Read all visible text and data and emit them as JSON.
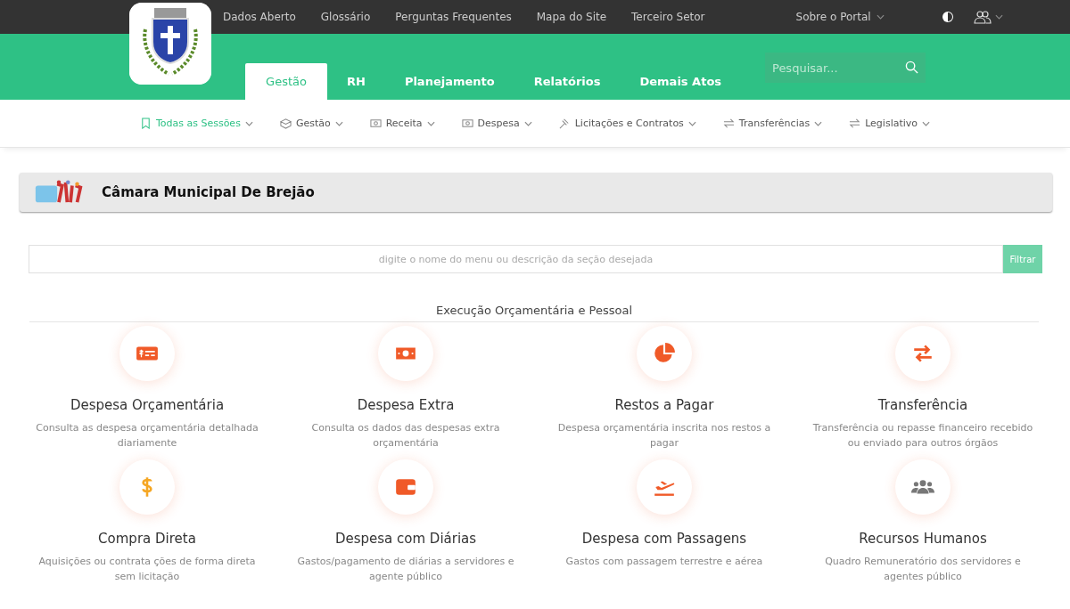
{
  "top_links": [
    "Dados Aberto",
    "Glossário",
    "Perguntas Frequentes",
    "Mapa do Site",
    "Terceiro Setor"
  ],
  "portal_menu": "Sobre o Portal",
  "tabs": [
    {
      "label": "Gestão",
      "selected": true
    },
    {
      "label": "RH",
      "selected": false
    },
    {
      "label": "Planejamento",
      "selected": false
    },
    {
      "label": "Relatórios",
      "selected": false
    },
    {
      "label": "Demais Atos",
      "selected": false
    }
  ],
  "search": {
    "placeholder": "Pesquisar..."
  },
  "subnav": [
    {
      "label": "Todas as Sessões",
      "kind": "bookmark",
      "selected": true
    },
    {
      "label": "Gestão",
      "kind": "box",
      "selected": false
    },
    {
      "label": "Receita",
      "kind": "money",
      "selected": false
    },
    {
      "label": "Despesa",
      "kind": "money",
      "selected": false
    },
    {
      "label": "Licitações e Contratos",
      "kind": "gavel",
      "selected": false
    },
    {
      "label": "Transferências",
      "kind": "exchange",
      "selected": false
    },
    {
      "label": "Legislativo",
      "kind": "exchange",
      "selected": false
    }
  ],
  "entity": {
    "title": "Câmara Municipal De Brejão"
  },
  "filter": {
    "placeholder": "digite o nome do menu ou descrição da seção desejada",
    "button": "Filtrar"
  },
  "section": {
    "title": "Execução Orçamentária e Pessoal",
    "cards": [
      {
        "kind": "check",
        "title": "Despesa Orçamentária",
        "description": "Consulta as despesa orçamentária detalhada diariamente"
      },
      {
        "kind": "bill",
        "title": "Despesa Extra",
        "description": "Consulta os dados das despesas extra orçamentária"
      },
      {
        "kind": "pie",
        "title": "Restos a Pagar",
        "description": "Despesa orçamentária inscrita nos restos a pagar"
      },
      {
        "kind": "exchange",
        "title": "Transferência",
        "description": "Transferência ou repasse financeiro recebido ou enviado para outros órgãos"
      },
      {
        "kind": "dollar",
        "title": "Compra Direta",
        "description": "Aquisições ou contrata ções de forma direta sem licitação"
      },
      {
        "kind": "wallet",
        "title": "Despesa com Diárias",
        "description": "Gastos/pagamento de diárias a servidores e agente público"
      },
      {
        "kind": "plane",
        "title": "Despesa com Passagens",
        "description": "Gastos com passagem terrestre e aérea"
      },
      {
        "kind": "users",
        "title": "Recursos Humanos",
        "description": "Quadro Remuneratório dos servidores e agentes público"
      }
    ]
  }
}
